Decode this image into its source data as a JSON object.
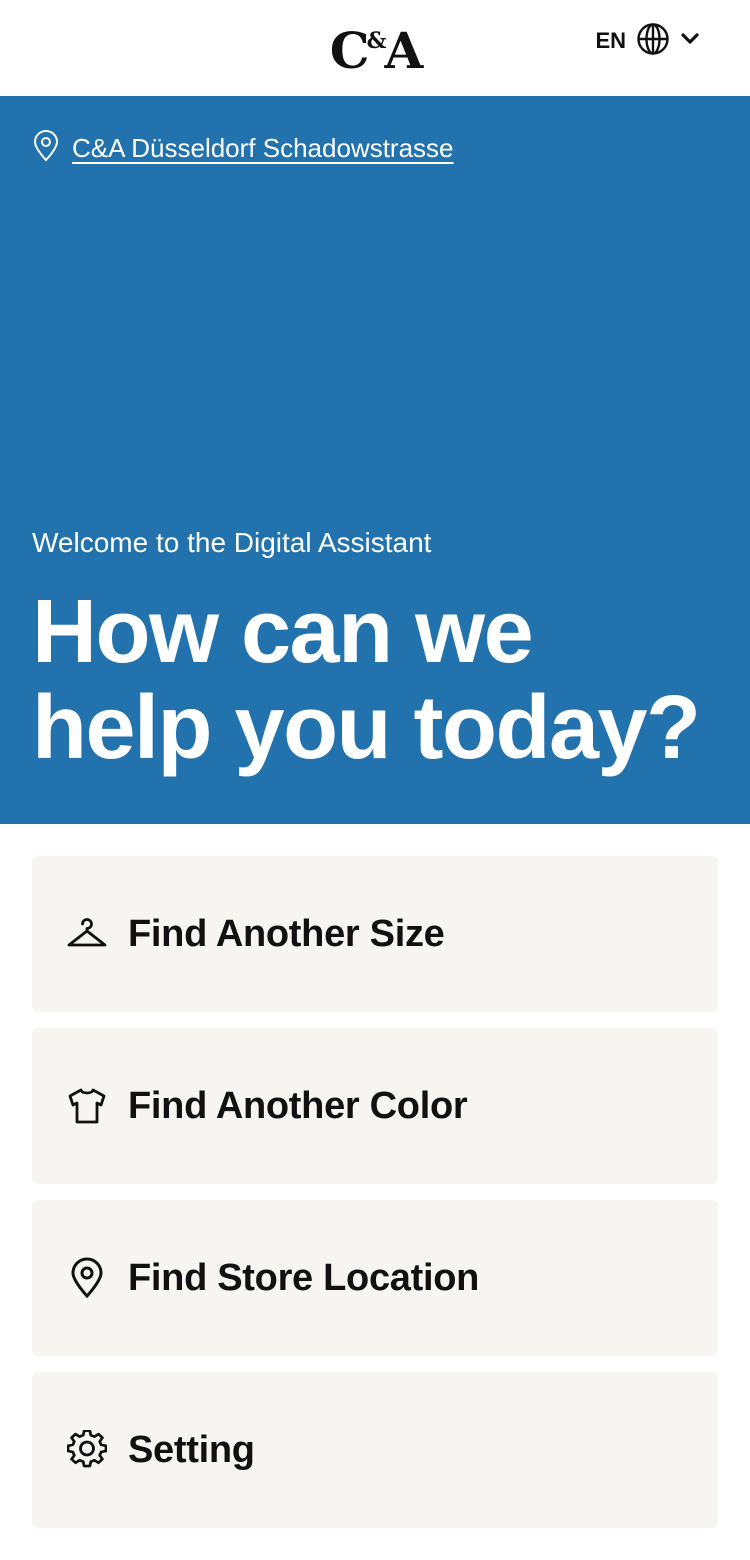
{
  "header": {
    "logo_main": "C",
    "logo_amp": "&",
    "logo_end": "A",
    "language_code": "EN"
  },
  "hero": {
    "store_name": "C&A Düsseldorf Schadowstrasse",
    "welcome": "Welcome to the Digital Assistant",
    "headline_line1": "How can we",
    "headline_line2": "help you today?",
    "background_color": "#2272ae"
  },
  "menu": {
    "items": [
      {
        "label": "Find Another Size",
        "icon": "hanger-icon"
      },
      {
        "label": "Find Another Color",
        "icon": "tshirt-icon"
      },
      {
        "label": "Find Store Location",
        "icon": "location-pin-icon"
      },
      {
        "label": "Setting",
        "icon": "gear-icon"
      }
    ]
  }
}
